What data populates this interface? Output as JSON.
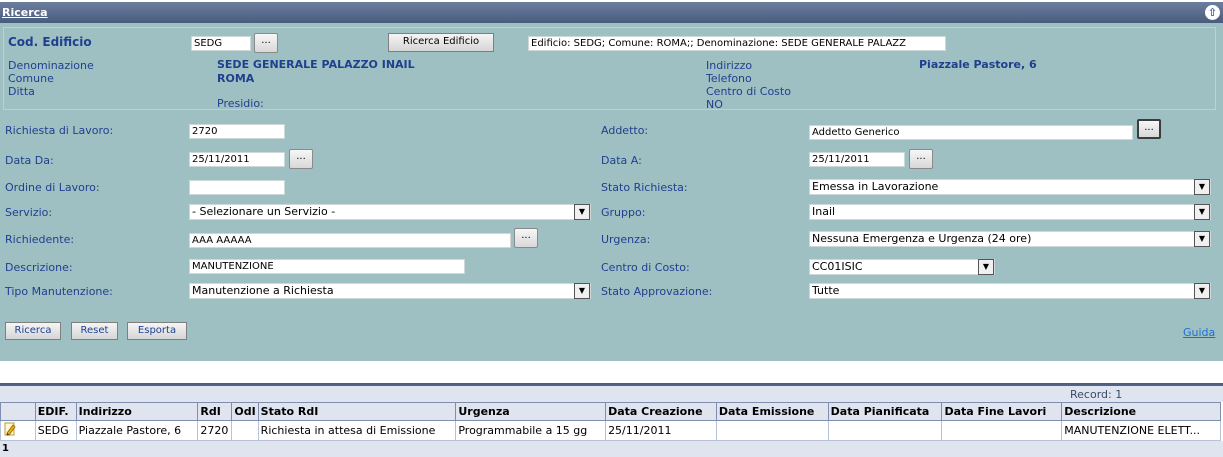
{
  "header": {
    "title": "Ricerca",
    "up_icon": "arrow-up-icon"
  },
  "building": {
    "code_label": "Cod. Edificio",
    "code_value": "SEDG",
    "search_button": "Ricerca Edificio",
    "summary": "Edificio: SEDG; Comune: ROMA;; Denominazione: SEDE GENERALE PALAZZ",
    "denominazione_label": "Denominazione",
    "denominazione_value": "SEDE GENERALE PALAZZO INAIL",
    "comune_label": "Comune",
    "comune_value": "ROMA",
    "ditta_label": "Ditta",
    "presidio_label": "Presidio:",
    "indirizzo_label": "Indirizzo",
    "indirizzo_value": "Piazzale Pastore, 6",
    "telefono_label": "Telefono",
    "centro_label": "Centro di Costo",
    "no_value": "NO"
  },
  "form": {
    "richiesta_label": "Richiesta di Lavoro:",
    "richiesta_value": "2720",
    "data_da_label": "Data Da:",
    "data_da_value": "25/11/2011",
    "ordine_label": "Ordine di Lavoro:",
    "ordine_value": "",
    "servizio_label": "Servizio:",
    "servizio_value": "- Selezionare un Servizio -",
    "richiedente_label": "Richiedente:",
    "richiedente_value": "AAA AAAAA",
    "descrizione_label": "Descrizione:",
    "descrizione_value": "MANUTENZIONE",
    "tipo_label": "Tipo Manutenzione:",
    "tipo_value": "Manutenzione a Richiesta",
    "addetto_label": "Addetto:",
    "addetto_value": "Addetto Generico",
    "data_a_label": "Data A:",
    "data_a_value": "25/11/2011",
    "stato_label": "Stato Richiesta:",
    "stato_value": "Emessa in Lavorazione",
    "gruppo_label": "Gruppo:",
    "gruppo_value": "Inail",
    "urgenza_label": "Urgenza:",
    "urgenza_value": "Nessuna Emergenza e Urgenza (24 ore)",
    "centro_label": "Centro di Costo:",
    "centro_value": "CC01ISIC",
    "approvazione_label": "Stato Approvazione:",
    "approvazione_value": "Tutte",
    "dots": "...",
    "ricerca_button": "Ricerca",
    "reset_button": "Reset",
    "esporta_button": "Esporta",
    "guida_link": "Guida"
  },
  "results": {
    "record_count": "Record: 1",
    "columns": [
      "",
      "EDIF.",
      "Indirizzo",
      "RdI",
      "OdI",
      "Stato RdI",
      "Urgenza",
      "Data Creazione",
      "Data Emissione",
      "Data Pianificata",
      "Data Fine Lavori",
      "Descrizione"
    ],
    "rows": [
      [
        "",
        "SEDG",
        "Piazzale Pastore, 6",
        "2720",
        "",
        "Richiesta in attesa di Emissione",
        "Programmabile a 15 gg",
        "25/11/2011",
        "",
        "",
        "",
        "MANUTENZIONE ELETT..."
      ]
    ],
    "page": "1",
    "row_icon": "pencil-icon"
  }
}
